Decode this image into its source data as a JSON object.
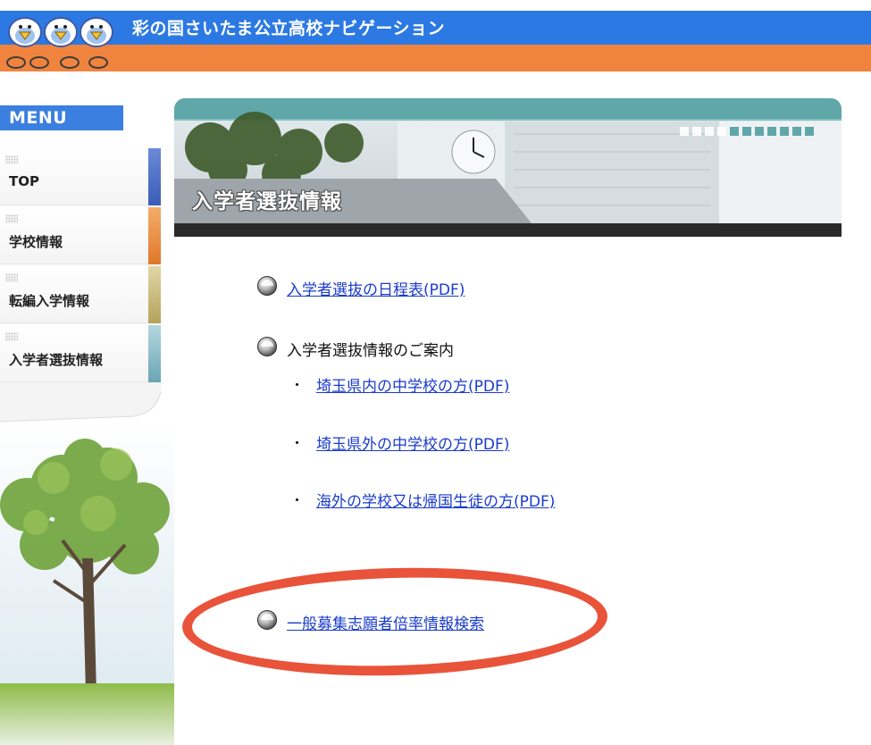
{
  "header": {
    "site_title": "彩の国さいたま公立高校ナビゲーション",
    "mascot_icon": "bird-mascots-icon",
    "colors": {
      "blue": "#2c79e3",
      "orange": "#f0843e"
    }
  },
  "sidebar": {
    "menu_label": "MENU",
    "items": [
      {
        "label": "TOP",
        "tab_color": "#4b6fc8"
      },
      {
        "label": "学校情報",
        "tab_color": "#e88a3c"
      },
      {
        "label": "転編入学情報",
        "tab_color": "#c9b874"
      },
      {
        "label": "入学者選抜情報",
        "tab_color": "#7fb3c0"
      }
    ]
  },
  "banner": {
    "title": "入学者選抜情報"
  },
  "content": {
    "schedule_link": "入学者選抜の日程表(PDF)",
    "guide_heading": "入学者選抜情報のご案内",
    "sub_links": [
      "埼玉県内の中学校の方(PDF)",
      "埼玉県外の中学校の方(PDF)",
      "海外の学校又は帰国生徒の方(PDF)"
    ],
    "ratio_search_link": "一般募集志願者倍率情報検索"
  },
  "annotation": {
    "highlight_color": "#e8533a"
  }
}
